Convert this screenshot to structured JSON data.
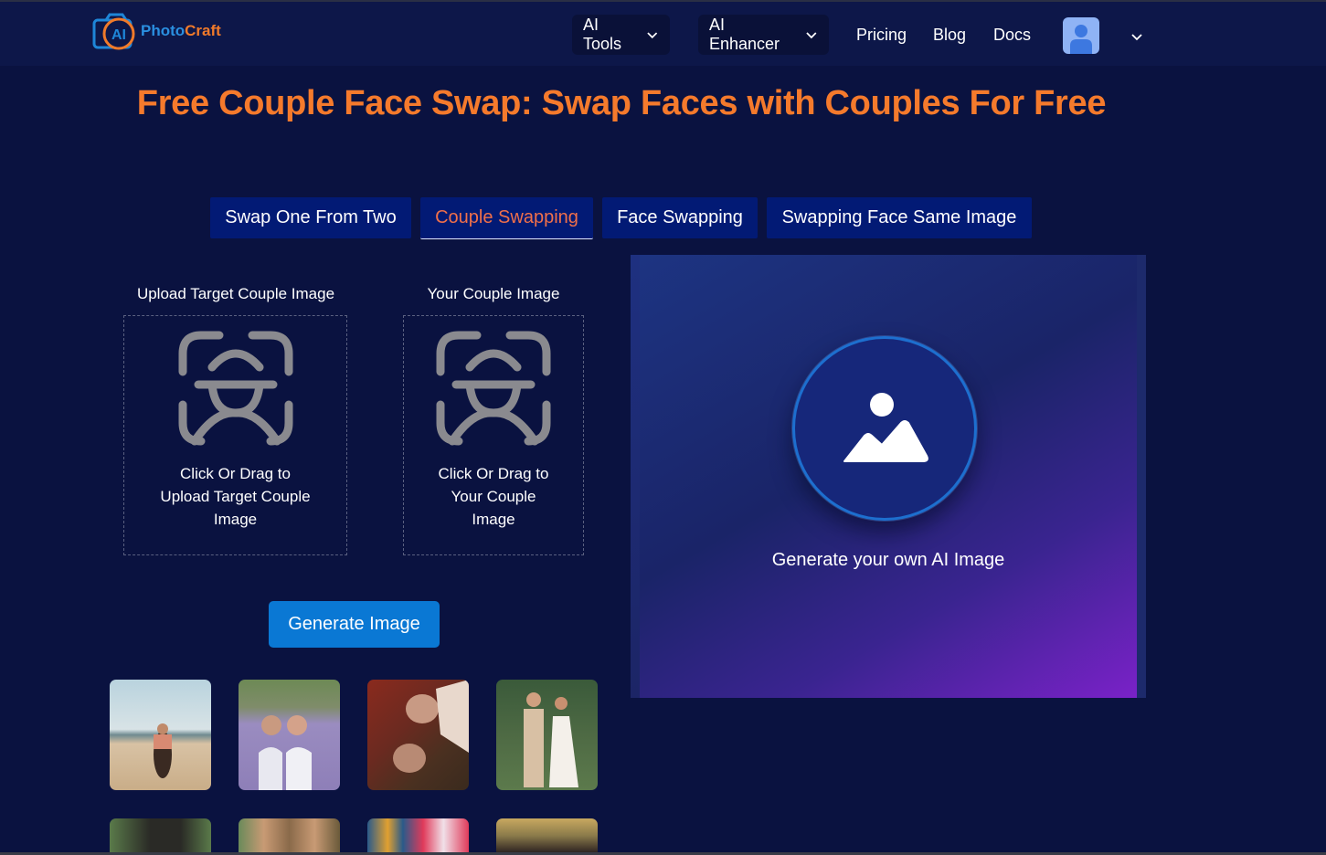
{
  "header": {
    "logo": {
      "text_part1": "AI ",
      "text_part2": "Photo",
      "text_part3": "Craft",
      "badge": "AI"
    },
    "nav": {
      "dropdowns": [
        {
          "label": "AI Tools",
          "icon": "chevron-down-icon"
        },
        {
          "label": "AI Enhancer",
          "icon": "chevron-down-icon"
        }
      ],
      "links": [
        "Pricing",
        "Blog",
        "Docs"
      ],
      "user_avatar_icon": "user-icon",
      "user_menu_icon": "chevron-down-icon"
    }
  },
  "page": {
    "title": "Free Couple Face Swap: Swap Faces with Couples For Free"
  },
  "tabs": [
    {
      "label": "Swap One From Two",
      "active": false
    },
    {
      "label": "Couple Swapping",
      "active": true
    },
    {
      "label": "Face Swapping",
      "active": false
    },
    {
      "label": "Swapping Face Same Image",
      "active": false
    }
  ],
  "uploads": [
    {
      "label": "Upload Target Couple Image",
      "drop_text_line1": "Click Or Drag to",
      "drop_text_line2": "Upload Target Couple",
      "drop_text_line3": "Image",
      "icon": "face-scan-icon"
    },
    {
      "label": "Your Couple Image",
      "drop_text_line1": "Click Or Drag to",
      "drop_text_line2": "Your Couple",
      "drop_text_line3": "Image",
      "icon": "face-scan-icon"
    }
  ],
  "generate_button": "Generate Image",
  "result_panel": {
    "icon": "image-placeholder-icon",
    "text": "Generate your own AI Image"
  },
  "samples": [
    {
      "name": "couple-beach-piggyback"
    },
    {
      "name": "couple-lavender-field"
    },
    {
      "name": "couple-lying-down"
    },
    {
      "name": "couple-wedding"
    },
    {
      "name": "couple-forest"
    },
    {
      "name": "couple-two-women"
    },
    {
      "name": "couple-graffiti"
    },
    {
      "name": "couple-park"
    }
  ],
  "colors": {
    "accent_orange": "#f57a2c",
    "tab_bg": "#021a75",
    "button_blue": "#0a78d4",
    "page_bg": "#0a1240"
  }
}
